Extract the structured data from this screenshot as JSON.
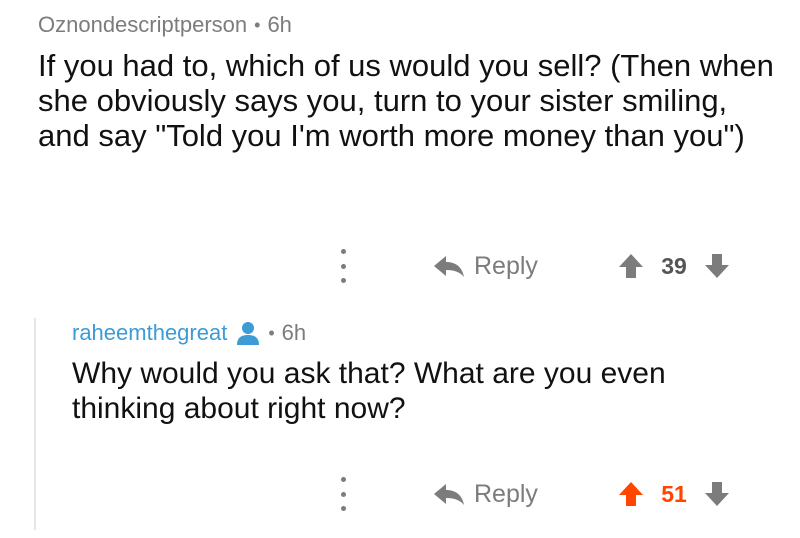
{
  "comment1": {
    "author": "Oznondescriptperson",
    "time": "6h",
    "body": "If you had to, which of us would you sell? (Then when she obviously says you, turn to your sister smiling, and say \"Told you I'm worth more money than you\")",
    "reply_label": "Reply",
    "score": "39"
  },
  "comment2": {
    "author": "raheemthegreat",
    "time": "6h",
    "body": "Why would you ask that? What are you even thinking about right now?",
    "reply_label": "Reply",
    "score": "51"
  },
  "colors": {
    "username_blue": "#3d9bd6",
    "upvote_orange": "#ff4500",
    "muted_gray": "#7c7c7c"
  }
}
